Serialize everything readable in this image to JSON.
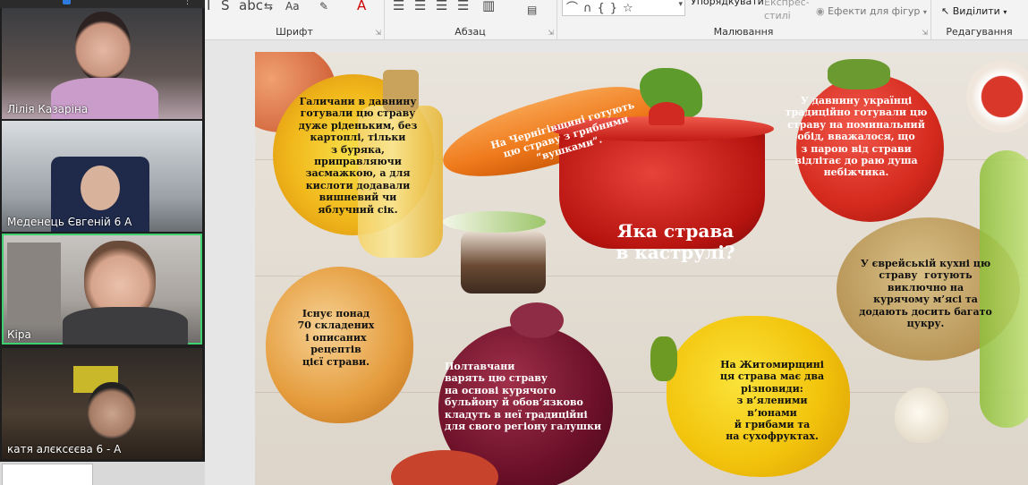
{
  "ribbon": {
    "groups": {
      "font": "Шрифт",
      "paragraph": "Абзац",
      "drawing": "Малювання",
      "editing": "Редагування"
    },
    "arrange_label": "Упорядкувати",
    "express_styles_label": "Експрес-\nстилі",
    "shape_effects_label": "Ефекти для фігур",
    "select_label": "Виділити"
  },
  "participants": [
    {
      "name": "Лілія Казаріна"
    },
    {
      "name": "Меденець Євгеній 6 А"
    },
    {
      "name": "Кіра"
    },
    {
      "name": "катя алєксєєва 6 - А"
    }
  ],
  "slide": {
    "title": "Яка страва\nв каструлі?",
    "blocks": {
      "galicia": "Галичани в давнину\nготували цю страву\nдуже ріденьким, без\nкартоплі, тільки\nз буряка,\nприправляючи\nзасмажкою, а для\nкислоти додавали\nвишневий чи\nяблучний сік.",
      "chernihiv": "На Чернігівщині готують\nцю страву з грибними\n“вушками”.",
      "memorial": "У давнину українці\nтрадиційно готували цю\nстраву на поминальний\nобід, вважалося, що\nз парою від страви\nвідлітає до раю душа\nнебіжчика.",
      "variants": "Існує понад\n70 складених\nі описаних\nрецептів\nцієї страви.",
      "poltava": "Полтавчани\nварять цю страву\nна основі курячого\nбульйону й обов’язково\nкладуть в неї традиційні\nдля свого регіону галушки",
      "zhytomyr": "На Житомирщині\nця страва має два\nрізновиди:\nз в’яленими\nв’юнами\nй грибами та\nна сухофруктах.",
      "jewish": "У єврейській кухні цю\nстраву  готують\nвиключно на\nкурячому м’ясі та\nдодають досить багато\nцукру."
    }
  }
}
